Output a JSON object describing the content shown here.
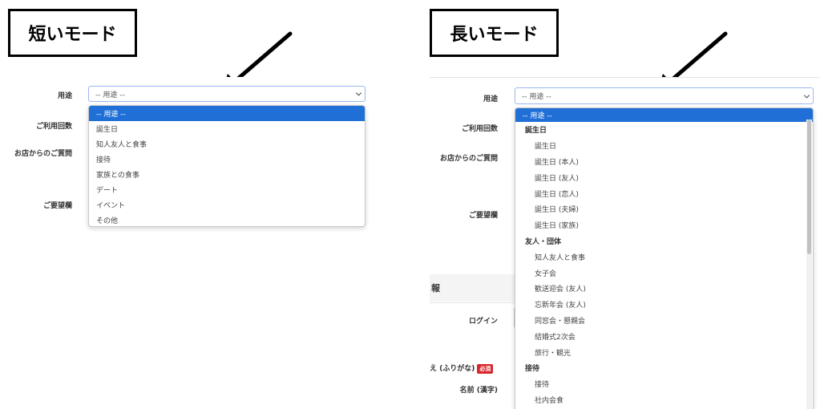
{
  "short_mode": {
    "title": "短いモード",
    "labels": {
      "purpose": "用途",
      "usage_count": "ご利用回数",
      "shop_question": "お店からのご質問",
      "request": "ご要望欄"
    },
    "select_value": "-- 用途 --",
    "options": [
      "-- 用途 --",
      "誕生日",
      "知人友人と食事",
      "接待",
      "家族との食事",
      "デート",
      "イベント",
      "その他"
    ]
  },
  "long_mode": {
    "title": "長いモード",
    "labels": {
      "purpose": "用途",
      "usage_count": "ご利用回数",
      "shop_question": "お店からのご質問",
      "request": "ご要望欄",
      "section_partial": "報",
      "login": "ログイン",
      "name_kana": "え (ふりがな)",
      "required_badge": "必須",
      "name_kanji": "名前 (漢字)"
    },
    "select_value": "-- 用途 --",
    "options": [
      {
        "type": "selected",
        "label": "-- 用途 --"
      },
      {
        "type": "group",
        "label": "誕生日"
      },
      {
        "type": "child",
        "label": "誕生日"
      },
      {
        "type": "child",
        "label": "誕生日 (本人)"
      },
      {
        "type": "child",
        "label": "誕生日 (友人)"
      },
      {
        "type": "child",
        "label": "誕生日 (恋人)"
      },
      {
        "type": "child",
        "label": "誕生日 (夫婦)"
      },
      {
        "type": "child",
        "label": "誕生日 (家族)"
      },
      {
        "type": "group",
        "label": "友人・団体"
      },
      {
        "type": "child",
        "label": "知人友人と食事"
      },
      {
        "type": "child",
        "label": "女子会"
      },
      {
        "type": "child",
        "label": "歓送迎会 (友人)"
      },
      {
        "type": "child",
        "label": "忘新年会 (友人)"
      },
      {
        "type": "child",
        "label": "同窓会・懇親会"
      },
      {
        "type": "child",
        "label": "結婚式2次会"
      },
      {
        "type": "child",
        "label": "旅行・観光"
      },
      {
        "type": "group",
        "label": "接待"
      },
      {
        "type": "child",
        "label": "接待"
      },
      {
        "type": "child",
        "label": "社内会食"
      }
    ]
  }
}
